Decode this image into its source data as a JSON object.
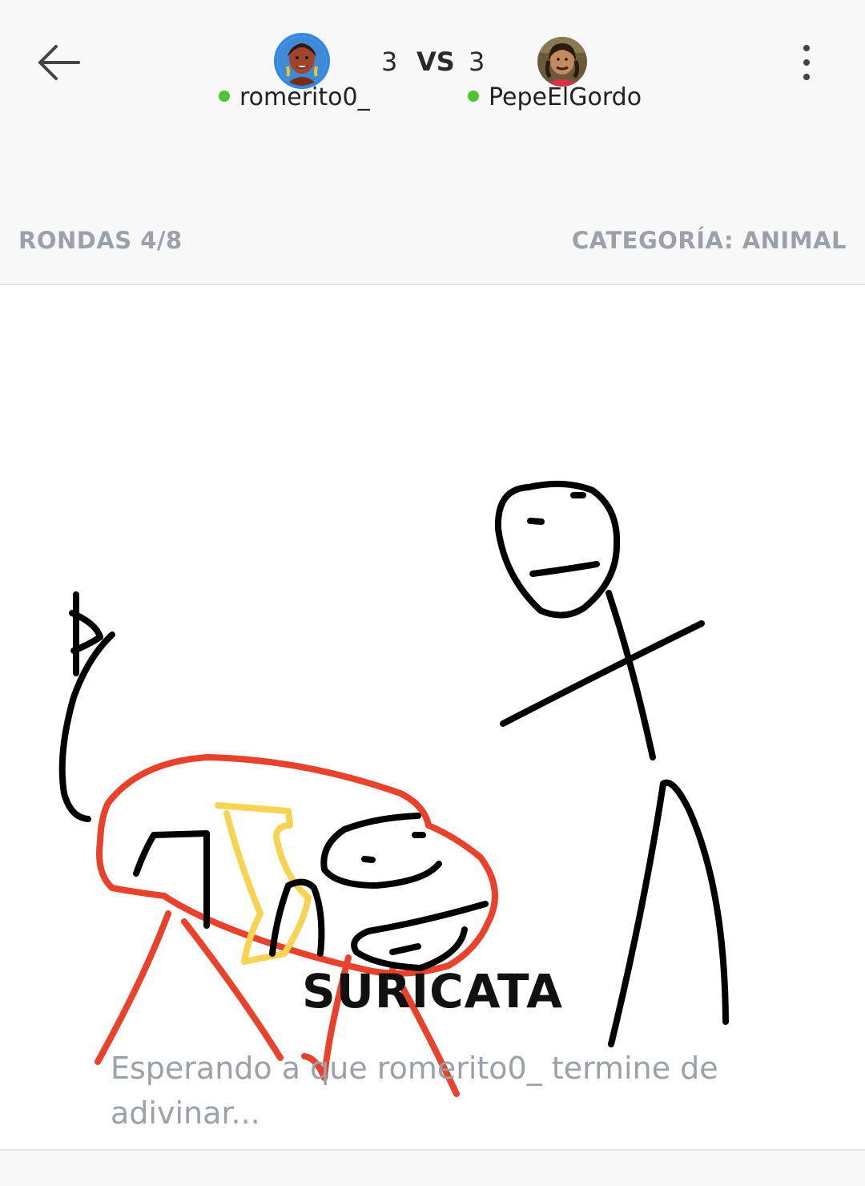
{
  "header": {
    "back_icon": "arrow-left-icon",
    "menu_icon": "more-vertical-icon",
    "player1": {
      "name": "romerito0_",
      "score": "3",
      "online_color": "#4cc431",
      "avatar_ring": "#2f88e8"
    },
    "vs_label": "VS",
    "player2": {
      "name": "PepeElGordo",
      "score": "3",
      "online_color": "#4cc431"
    },
    "rounds": "RONDAS 4/8",
    "category": "CATEGORÍA: ANIMAL"
  },
  "game": {
    "word": "SURICATA",
    "status": "Esperando a que romerito0_ termine de adivinar..."
  },
  "colors": {
    "stroke_black": "#000000",
    "stroke_red": "#e8412c",
    "stroke_yellow": "#f7d354",
    "muted_text": "#9aa1a8"
  }
}
